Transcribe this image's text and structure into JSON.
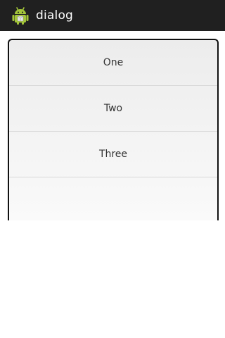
{
  "action_bar": {
    "title": "dialog",
    "icon": "android-robot-icon",
    "background": "#202020"
  },
  "dialog": {
    "items": [
      {
        "label": "One"
      },
      {
        "label": "Two"
      },
      {
        "label": "Three"
      }
    ]
  }
}
